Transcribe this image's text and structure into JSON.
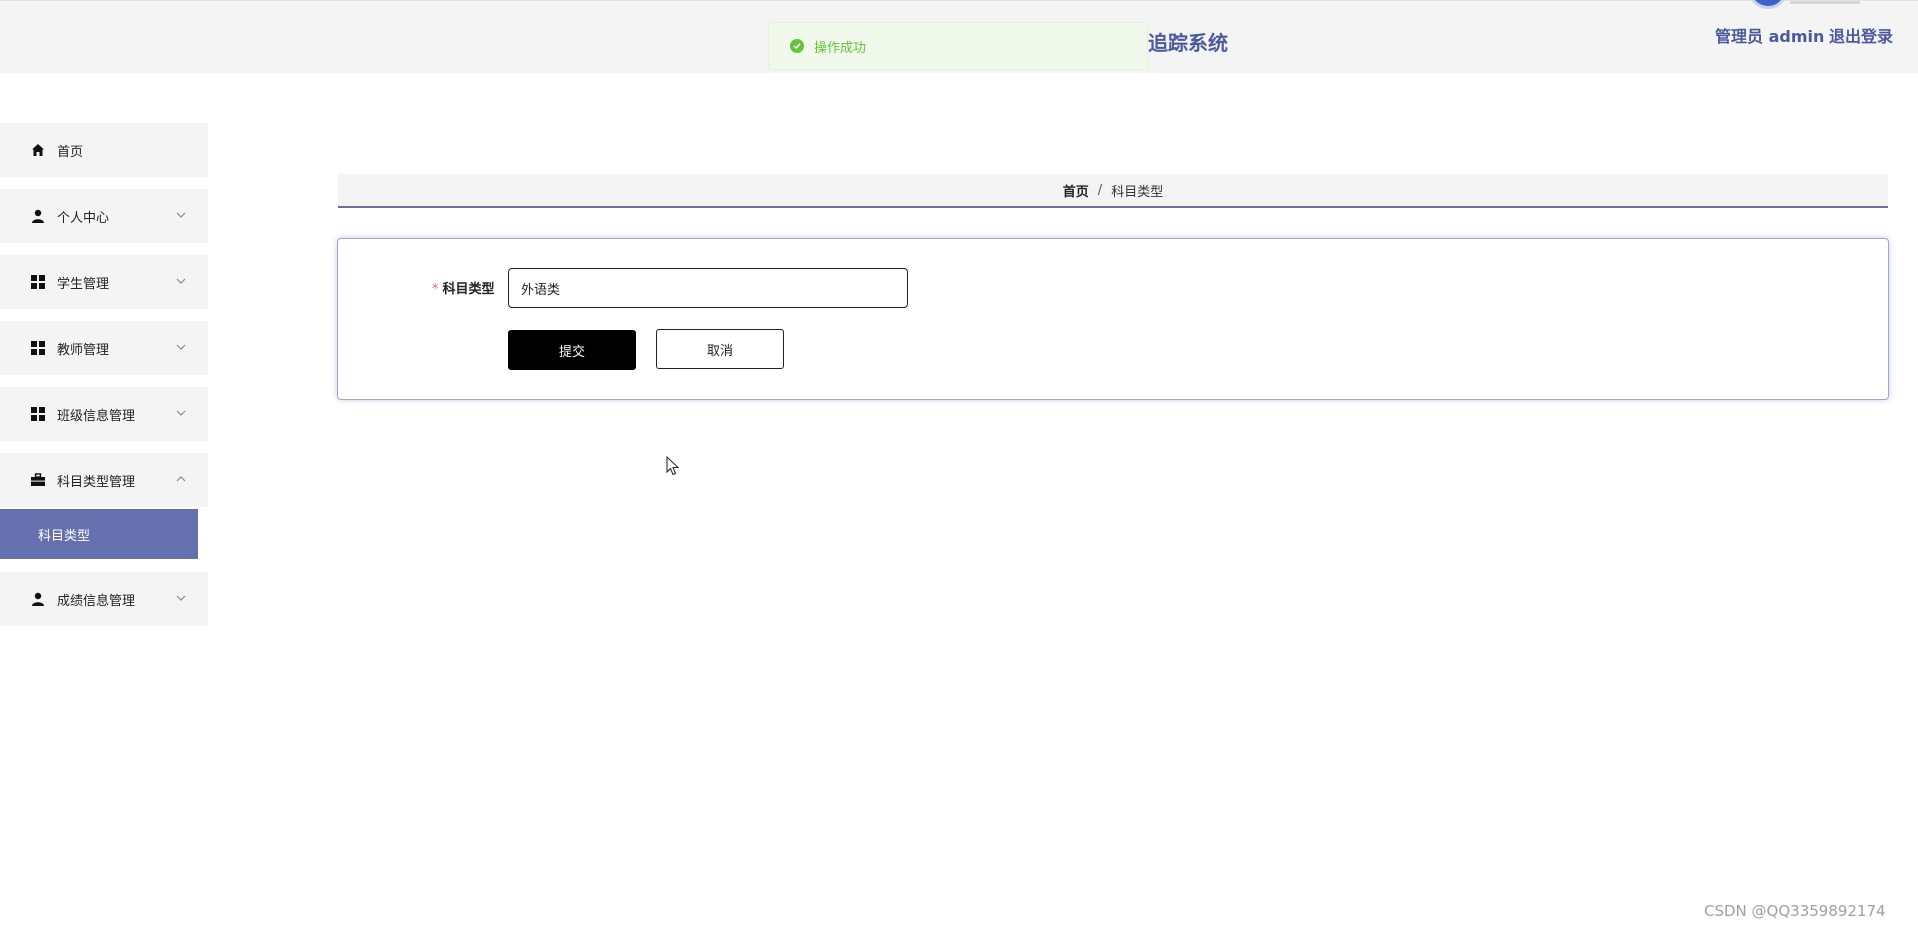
{
  "header": {
    "app_title": "追踪系统",
    "user_label": "管理员 admin",
    "logout_label": "退出登录"
  },
  "toast": {
    "message": "操作成功",
    "color": "#67c23a"
  },
  "sidebar": {
    "items": [
      {
        "label": "首页",
        "icon": "home-icon"
      },
      {
        "label": "个人中心",
        "icon": "user-icon",
        "expanded": false
      },
      {
        "label": "学生管理",
        "icon": "grid-icon",
        "expanded": false
      },
      {
        "label": "教师管理",
        "icon": "grid-icon",
        "expanded": false
      },
      {
        "label": "班级信息管理",
        "icon": "grid-icon",
        "expanded": false
      },
      {
        "label": "科目类型管理",
        "icon": "briefcase-icon",
        "expanded": true
      },
      {
        "label": "成绩信息管理",
        "icon": "user-icon",
        "expanded": false
      }
    ],
    "subitems": [
      {
        "label": "科目类型",
        "active": true
      }
    ],
    "active_color": "#6670af"
  },
  "breadcrumb": {
    "home": "首页",
    "separator": "/",
    "current": "科目类型"
  },
  "form": {
    "required_mark": "*",
    "field_label": "科目类型",
    "field_value": "外语类",
    "submit_label": "提交",
    "cancel_label": "取消"
  },
  "watermark": "CSDN @QQ3359892174"
}
